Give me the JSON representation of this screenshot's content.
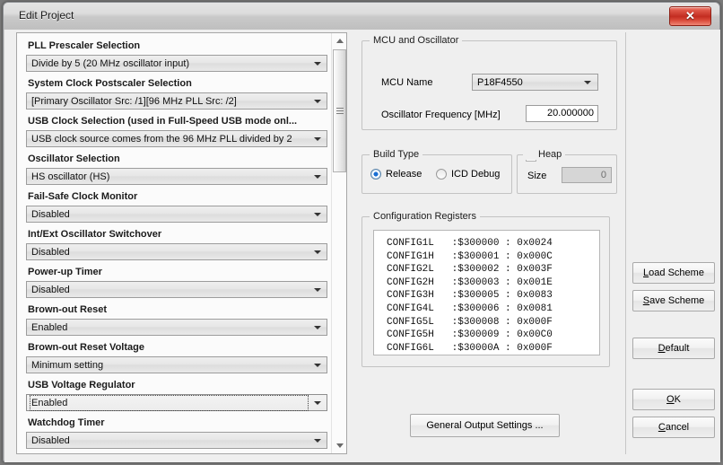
{
  "window": {
    "title": "Edit Project",
    "close_label": "✕"
  },
  "left_panel": {
    "fields": [
      {
        "label": "PLL Prescaler Selection",
        "value": "Divide by 5 (20 MHz oscillator input)",
        "focused": false
      },
      {
        "label": "System Clock Postscaler Selection",
        "value": "[Primary Oscillator Src: /1][96 MHz PLL Src: /2]",
        "focused": false
      },
      {
        "label": "USB Clock Selection (used in Full-Speed USB mode onl...",
        "value": "USB clock source comes from the 96 MHz PLL divided by 2",
        "focused": false
      },
      {
        "label": "Oscillator Selection",
        "value": "HS oscillator (HS)",
        "focused": false
      },
      {
        "label": "Fail-Safe Clock Monitor",
        "value": "Disabled",
        "focused": false
      },
      {
        "label": "Int/Ext Oscillator Switchover",
        "value": "Disabled",
        "focused": false
      },
      {
        "label": "Power-up Timer",
        "value": "Disabled",
        "focused": false
      },
      {
        "label": "Brown-out Reset",
        "value": "Enabled",
        "focused": false
      },
      {
        "label": "Brown-out Reset Voltage",
        "value": "Minimum setting",
        "focused": false
      },
      {
        "label": "USB Voltage Regulator",
        "value": "Enabled",
        "focused": true
      },
      {
        "label": "Watchdog Timer",
        "value": "Disabled",
        "focused": false
      }
    ]
  },
  "mcu_group": {
    "legend": "MCU and Oscillator",
    "mcu_name_label": "MCU Name",
    "mcu_name_value": "P18F4550",
    "osc_freq_label": "Oscillator Frequency [MHz]",
    "osc_freq_value": "20.000000"
  },
  "build_group": {
    "legend": "Build Type",
    "release_label": "Release",
    "icd_label": "ICD Debug",
    "selected": "Release"
  },
  "heap_group": {
    "legend": "Heap",
    "checked": false,
    "size_label": "Size",
    "size_value": "0"
  },
  "config_group": {
    "legend": "Configuration Registers",
    "rows": [
      "CONFIG1L   :$300000 : 0x0024",
      "CONFIG1H   :$300001 : 0x000C",
      "CONFIG2L   :$300002 : 0x003F",
      "CONFIG2H   :$300003 : 0x001E",
      "CONFIG3H   :$300005 : 0x0083",
      "CONFIG4L   :$300006 : 0x0081",
      "CONFIG5L   :$300008 : 0x000F",
      "CONFIG5H   :$300009 : 0x00C0",
      "CONFIG6L   :$30000A : 0x000F"
    ]
  },
  "buttons": {
    "general_output": "General Output Settings ...",
    "load_scheme": {
      "pre": "",
      "accel": "L",
      "post": "oad Scheme"
    },
    "save_scheme": {
      "pre": "",
      "accel": "S",
      "post": "ave Scheme"
    },
    "default": {
      "pre": "",
      "accel": "D",
      "post": "efault"
    },
    "ok": {
      "pre": "",
      "accel": "O",
      "post": "K"
    },
    "cancel": {
      "pre": "",
      "accel": "C",
      "post": "ancel"
    }
  },
  "scrollbar": {
    "up_arrow": "up-arrow",
    "down_arrow": "down-arrow"
  }
}
